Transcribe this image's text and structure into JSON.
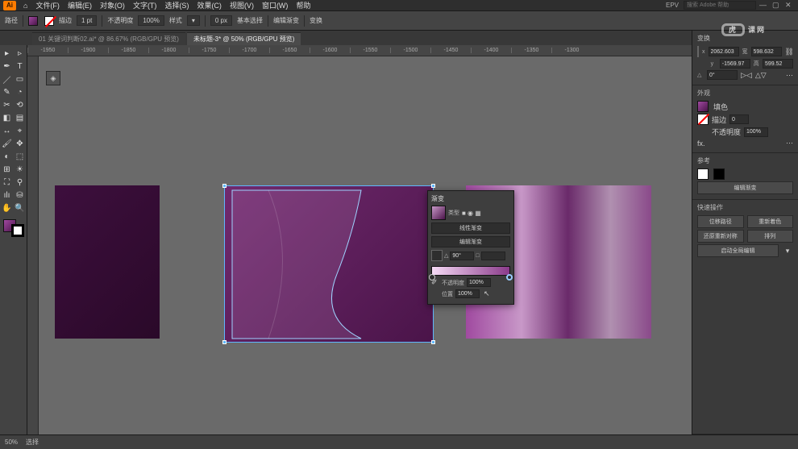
{
  "app": {
    "logo": "Ai",
    "home_icon": "⌂"
  },
  "menu": [
    "文件(F)",
    "编辑(E)",
    "对象(O)",
    "文字(T)",
    "选择(S)",
    "效果(C)",
    "视图(V)",
    "窗口(W)",
    "帮助"
  ],
  "header_right": {
    "workspace": "EPV",
    "search_placeholder": "搜索 Adobe 帮助"
  },
  "optionbar": {
    "label_path": "路径",
    "fill_tip": "填色",
    "stroke_tip": "描边",
    "stroke_w": "",
    "stroke_unit": "1 pt",
    "opacity_label": "不透明度",
    "opacity_val": "100%",
    "style_label": "样式",
    "pt_label": "0 px",
    "align_label": "基本选择",
    "transform_label": "编辑渐变",
    "shape_label": "变换"
  },
  "tabs": [
    {
      "label": "01 关键词判断02.ai* @ 86.67% (RGB/GPU 预览)",
      "active": false
    },
    {
      "label": "未标题-3* @ 50% (RGB/GPU 预览)",
      "active": true
    }
  ],
  "ruler_marks": [
    "-1950",
    "-1900",
    "-1850",
    "-1800",
    "-1750",
    "-1700",
    "-1650",
    "-1600",
    "-1550",
    "-1500",
    "-1450",
    "-1400",
    "-1350",
    "-1300"
  ],
  "tools_rows": [
    [
      "▸",
      "▹"
    ],
    [
      "✒",
      "T"
    ],
    [
      "／",
      "▭"
    ],
    [
      "✎",
      "◔"
    ],
    [
      "✂",
      "⟲"
    ],
    [
      "◧",
      "▤"
    ],
    [
      "↔",
      "⌖"
    ],
    [
      "🖌",
      "✥"
    ],
    [
      "◐",
      "⬚"
    ],
    [
      "⊞",
      "☀"
    ],
    [
      "⛶",
      "⚲"
    ],
    [
      "ılı",
      "⛁"
    ],
    [
      "✋",
      "🔍"
    ]
  ],
  "properties": {
    "section_transform": "变换",
    "x": "2062.603",
    "w": "598.632",
    "y": "-1569.97",
    "h": "599.52",
    "angle": "0°",
    "section_appearance": "外观",
    "fill_label": "填色",
    "stroke_label": "描边",
    "stroke_val": "0",
    "opacity_label": "不透明度",
    "opacity_val": "100%",
    "fx_label": "fx.",
    "section_quick": "参考",
    "btn_group": "编辑渐变",
    "section_align": "快速操作",
    "qa1": "位移路径",
    "qa2": "重新着色",
    "qa3": "还原重新对称",
    "qa4": "排列",
    "qa5": "启动全局编辑"
  },
  "gradient_panel": {
    "title": "渐变",
    "type_label": "类型",
    "type_val": "线性渐变",
    "edit_label": "编辑渐变",
    "angle_label": "△",
    "angle_val": "90°",
    "ratio_label": "□",
    "ratio_val": "",
    "opacity_label": "不透明度",
    "opacity_val": "100%",
    "location_label": "位置",
    "location_val": "100%"
  },
  "status": {
    "zoom": "50%",
    "info": "选择"
  },
  "watermark": {
    "a": "虎",
    "b": "课网"
  },
  "layer_icon": "◈"
}
